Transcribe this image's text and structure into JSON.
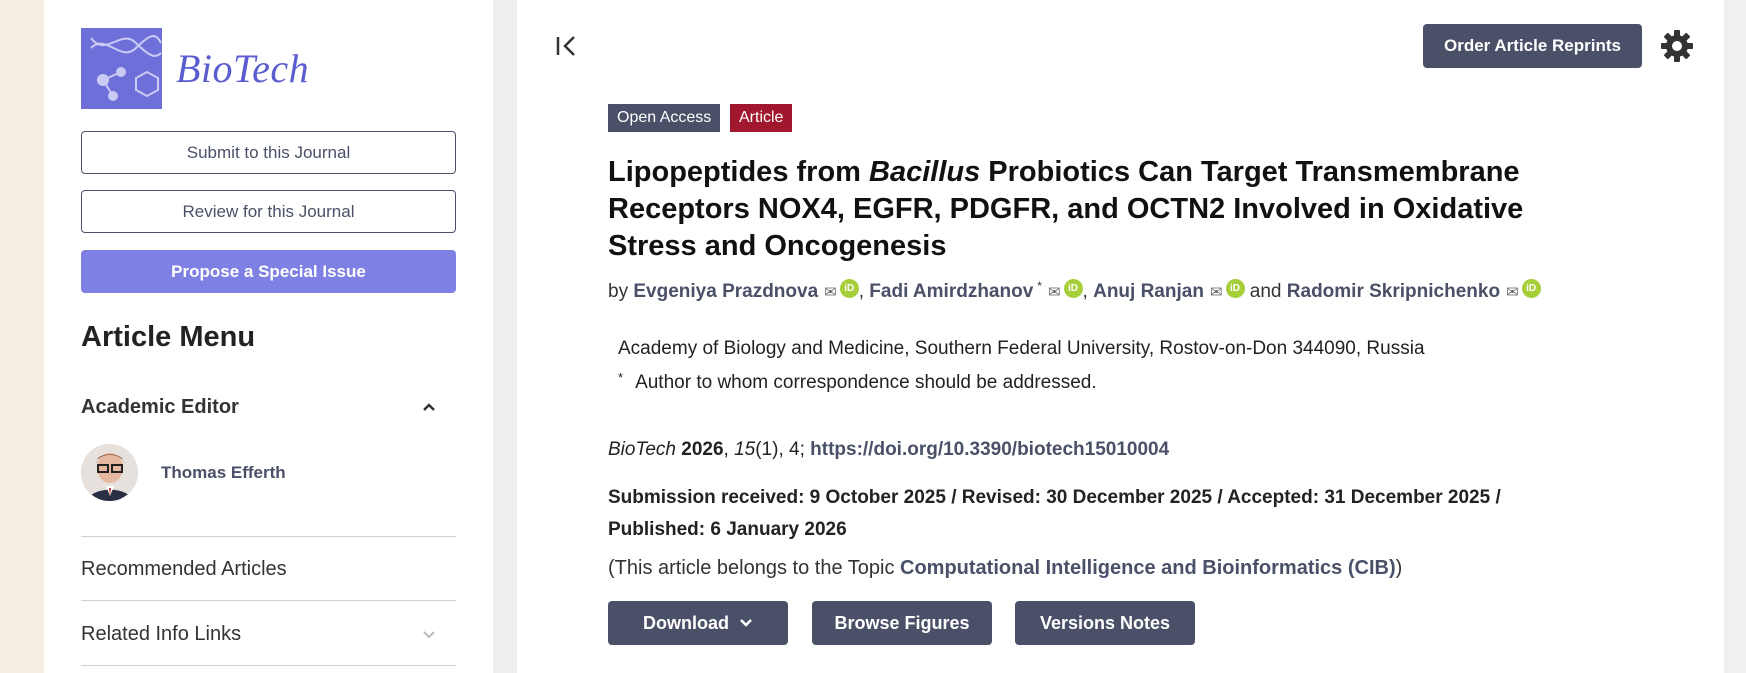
{
  "journal": {
    "logo_text": "BioTech"
  },
  "sidebar": {
    "submit_label": "Submit to this Journal",
    "review_label": "Review for this Journal",
    "propose_label": "Propose a Special Issue",
    "menu_title": "Article Menu",
    "academic_editor_label": "Academic Editor",
    "editor_name": "Thomas Efferth",
    "recommended_label": "Recommended Articles",
    "related_label": "Related Info Links"
  },
  "header": {
    "reprints_label": "Order Article Reprints"
  },
  "article": {
    "badges": {
      "open_access": "Open Access",
      "type": "Article"
    },
    "title_before": "Lipopeptides from ",
    "title_italic": "Bacillus",
    "title_after": " Probiotics Can Target Transmembrane Receptors NOX4, EGFR, PDGFR, and OCTN2 Involved in Oxidative Stress and Oncogenesis",
    "by": "by",
    "authors": [
      {
        "name": "Evgeniya Prazdnova"
      },
      {
        "name": "Fadi Amirdzhanov",
        "corresponding": "*"
      },
      {
        "name": "Anuj Ranjan"
      },
      {
        "name": "Radomir Skripnichenko"
      }
    ],
    "and_word": "and",
    "affiliation": "Academy of Biology and Medicine, Southern Federal University, Rostov-on-Don 344090, Russia",
    "corr_star": "*",
    "corr_note": "Author to whom correspondence should be addressed.",
    "citation": {
      "journal": "BioTech",
      "year": "2026",
      "volume": "15",
      "issue_page": "(1), 4; ",
      "doi": "https://doi.org/10.3390/biotech15010004"
    },
    "dates": "Submission received: 9 October 2025 / Revised: 30 December 2025 / Accepted: 31 December 2025 / Published: 6 January 2026",
    "topic_prefix": "(This article belongs to the Topic ",
    "topic_link": "Computational Intelligence and Bioinformatics (CIB)",
    "topic_suffix": ")"
  },
  "actions": {
    "download_label": "Download",
    "browse_label": "Browse Figures",
    "versions_label": "Versions Notes"
  },
  "colors": {
    "brand_dark": "#4a5068",
    "accent_purple": "#7f80e3",
    "article_badge": "#a1172d",
    "orcid_green": "#a6ce39"
  },
  "icons": [
    "collapse-sidebar-icon",
    "gear-icon",
    "mail-icon",
    "orcid-icon",
    "chevron-up-icon",
    "chevron-down-icon"
  ]
}
